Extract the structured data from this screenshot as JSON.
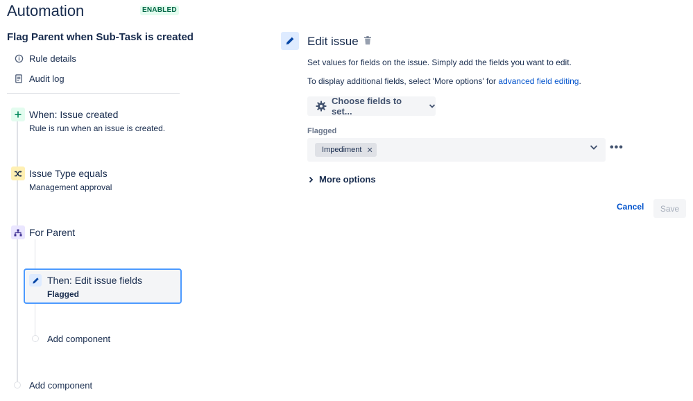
{
  "header": {
    "app_title": "Automation",
    "status": "ENABLED",
    "rule_name": "Flag Parent when Sub-Task is created"
  },
  "nav": {
    "items": [
      {
        "label": "Rule details",
        "icon": "info-icon"
      },
      {
        "label": "Audit log",
        "icon": "audit-log-icon"
      }
    ]
  },
  "timeline": {
    "trigger": {
      "title": "When: Issue created",
      "subtitle": "Rule is run when an issue is created.",
      "icon": "plus-icon",
      "color": "#57d9a3"
    },
    "condition": {
      "title": "Issue Type equals",
      "subtitle": "Management approval",
      "icon": "shuffle-icon",
      "color": "#ffe380"
    },
    "branch": {
      "title": "For Parent",
      "icon": "hierarchy-icon",
      "color": "#c0b6f2"
    },
    "action": {
      "title": "Then: Edit issue fields",
      "subtitle": "Flagged",
      "icon": "pencil-icon"
    },
    "add_component_inner": "Add component",
    "add_component_outer": "Add component"
  },
  "panel": {
    "title": "Edit issue",
    "description_1": "Set values for fields on the issue. Simply add the fields you want to edit.",
    "description_2_prefix": "To display additional fields, select 'More options' for ",
    "description_2_link": "advanced field editing",
    "description_2_suffix": ".",
    "choose_fields_label": "Choose fields to set...",
    "field": {
      "label": "Flagged",
      "selected_tag": "Impediment"
    },
    "more_options_label": "More options",
    "cancel_label": "Cancel",
    "save_label": "Save"
  },
  "colors": {
    "accent": "#0052cc",
    "selection_border": "#4c9aff",
    "text": "#172b4d"
  }
}
